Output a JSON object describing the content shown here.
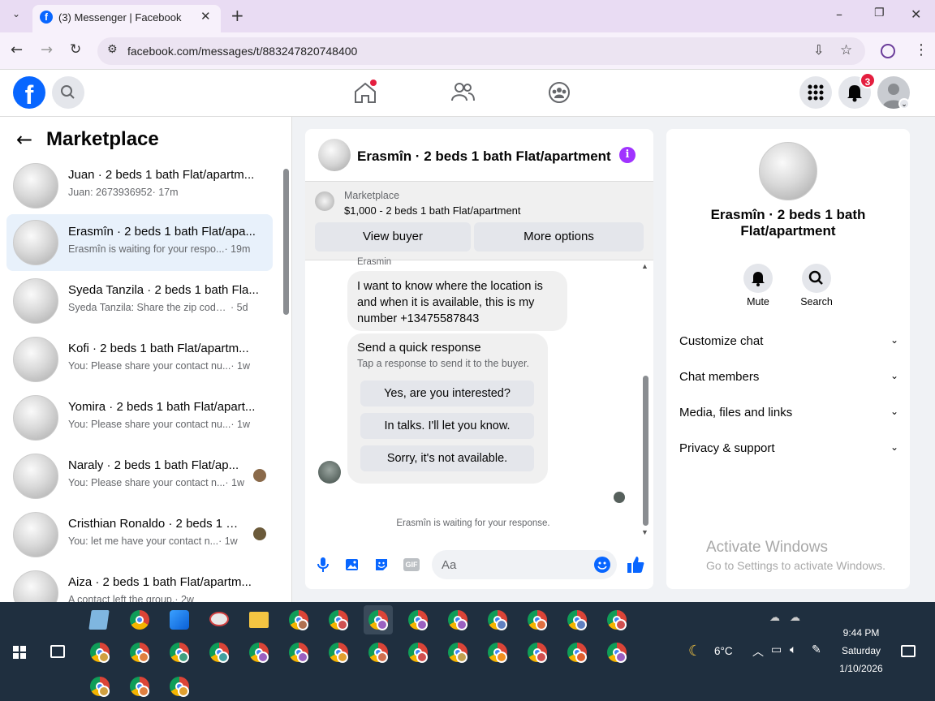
{
  "browser": {
    "tab_title": "(3) Messenger | Facebook",
    "url": "facebook.com/messages/t/883247820748400"
  },
  "header": {
    "notification_count": "3"
  },
  "left": {
    "title": "Marketplace",
    "conversations": [
      {
        "title": "Juan · 2 beds 1 bath Flat/apartm...",
        "preview": "Juan: 2673936952",
        "time": "· 17m"
      },
      {
        "title": "Erasmîn · 2 beds 1 bath Flat/apa...",
        "preview": "Erasmîn is waiting for your respo...",
        "time": "· 19m"
      },
      {
        "title": "Syeda Tanzila · 2 beds 1 bath Fla...",
        "preview": "Syeda Tanzila: Share the zip code fi...",
        "time": "· 5d"
      },
      {
        "title": "Kofi · 2 beds 1 bath Flat/apartm...",
        "preview": "You: Please share your contact nu...",
        "time": "· 1w"
      },
      {
        "title": "Yomira · 2 beds 1 bath Flat/apart...",
        "preview": "You: Please share your contact nu...",
        "time": "· 1w"
      },
      {
        "title": "Naraly · 2 beds 1 bath Flat/ap...",
        "preview": "You: Please share your contact n...",
        "time": "· 1w"
      },
      {
        "title": "Cristhian Ronaldo · 2 beds 1 b...",
        "preview": "You: let me have your contact n...",
        "time": "· 1w"
      },
      {
        "title": "Aiza · 2 beds 1 bath Flat/apartm...",
        "preview": "A contact left the group.",
        "time": "· 2w"
      }
    ]
  },
  "chat": {
    "title": "Erasmîn · 2 beds 1 bath Flat/apartment",
    "listing_source": "Marketplace",
    "listing": "$1,000 - 2 beds 1 bath Flat/apartment",
    "view_buyer": "View buyer",
    "more_options": "More options",
    "sender_name": "Erasmin",
    "message": "I want to know where the location is and when it is available, this is my number +13475587843",
    "quick_title": "Send a quick response",
    "quick_sub": "Tap a response to send it to the buyer.",
    "quick_replies": [
      "Yes, are you interested?",
      "In talks. I'll let you know.",
      "Sorry, it's not available."
    ],
    "status": "Erasmîn is waiting for your response.",
    "composer_placeholder": "Aa"
  },
  "right": {
    "name": "Erasmîn · 2 beds 1 bath Flat/apartment",
    "mute": "Mute",
    "search": "Search",
    "sections": [
      "Customize chat",
      "Chat members",
      "Media, files and links",
      "Privacy & support"
    ],
    "watermark_title": "Activate Windows",
    "watermark_sub": "Go to Settings to activate Windows."
  },
  "taskbar": {
    "temp": "6°C",
    "time": "9:44 PM",
    "day": "Saturday",
    "date": "1/10/2026"
  },
  "colors": {
    "fb_blue": "#0866ff",
    "accent_purple": "#a033ff",
    "notif_red": "#e41e3f"
  }
}
